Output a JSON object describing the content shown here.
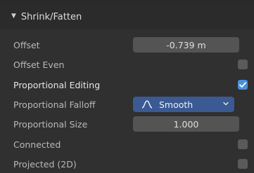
{
  "panel": {
    "title": "Shrink/Fatten",
    "expanded": true
  },
  "rows": {
    "offset": {
      "label": "Offset",
      "value": "-0.739 m"
    },
    "offset_even": {
      "label": "Offset Even",
      "checked": false
    },
    "proportional_editing": {
      "label": "Proportional Editing",
      "checked": true
    },
    "proportional_falloff": {
      "label": "Proportional Falloff",
      "value": "Smooth",
      "icon": "smooth-falloff-icon"
    },
    "proportional_size": {
      "label": "Proportional Size",
      "value": "1.000"
    },
    "connected": {
      "label": "Connected",
      "checked": false
    },
    "projected": {
      "label": "Projected (2D)",
      "checked": false
    }
  },
  "colors": {
    "accent": "#3b5a93",
    "checkbox_on": "#4a90d9",
    "field_bg": "#545454",
    "panel_bg": "#303030"
  }
}
